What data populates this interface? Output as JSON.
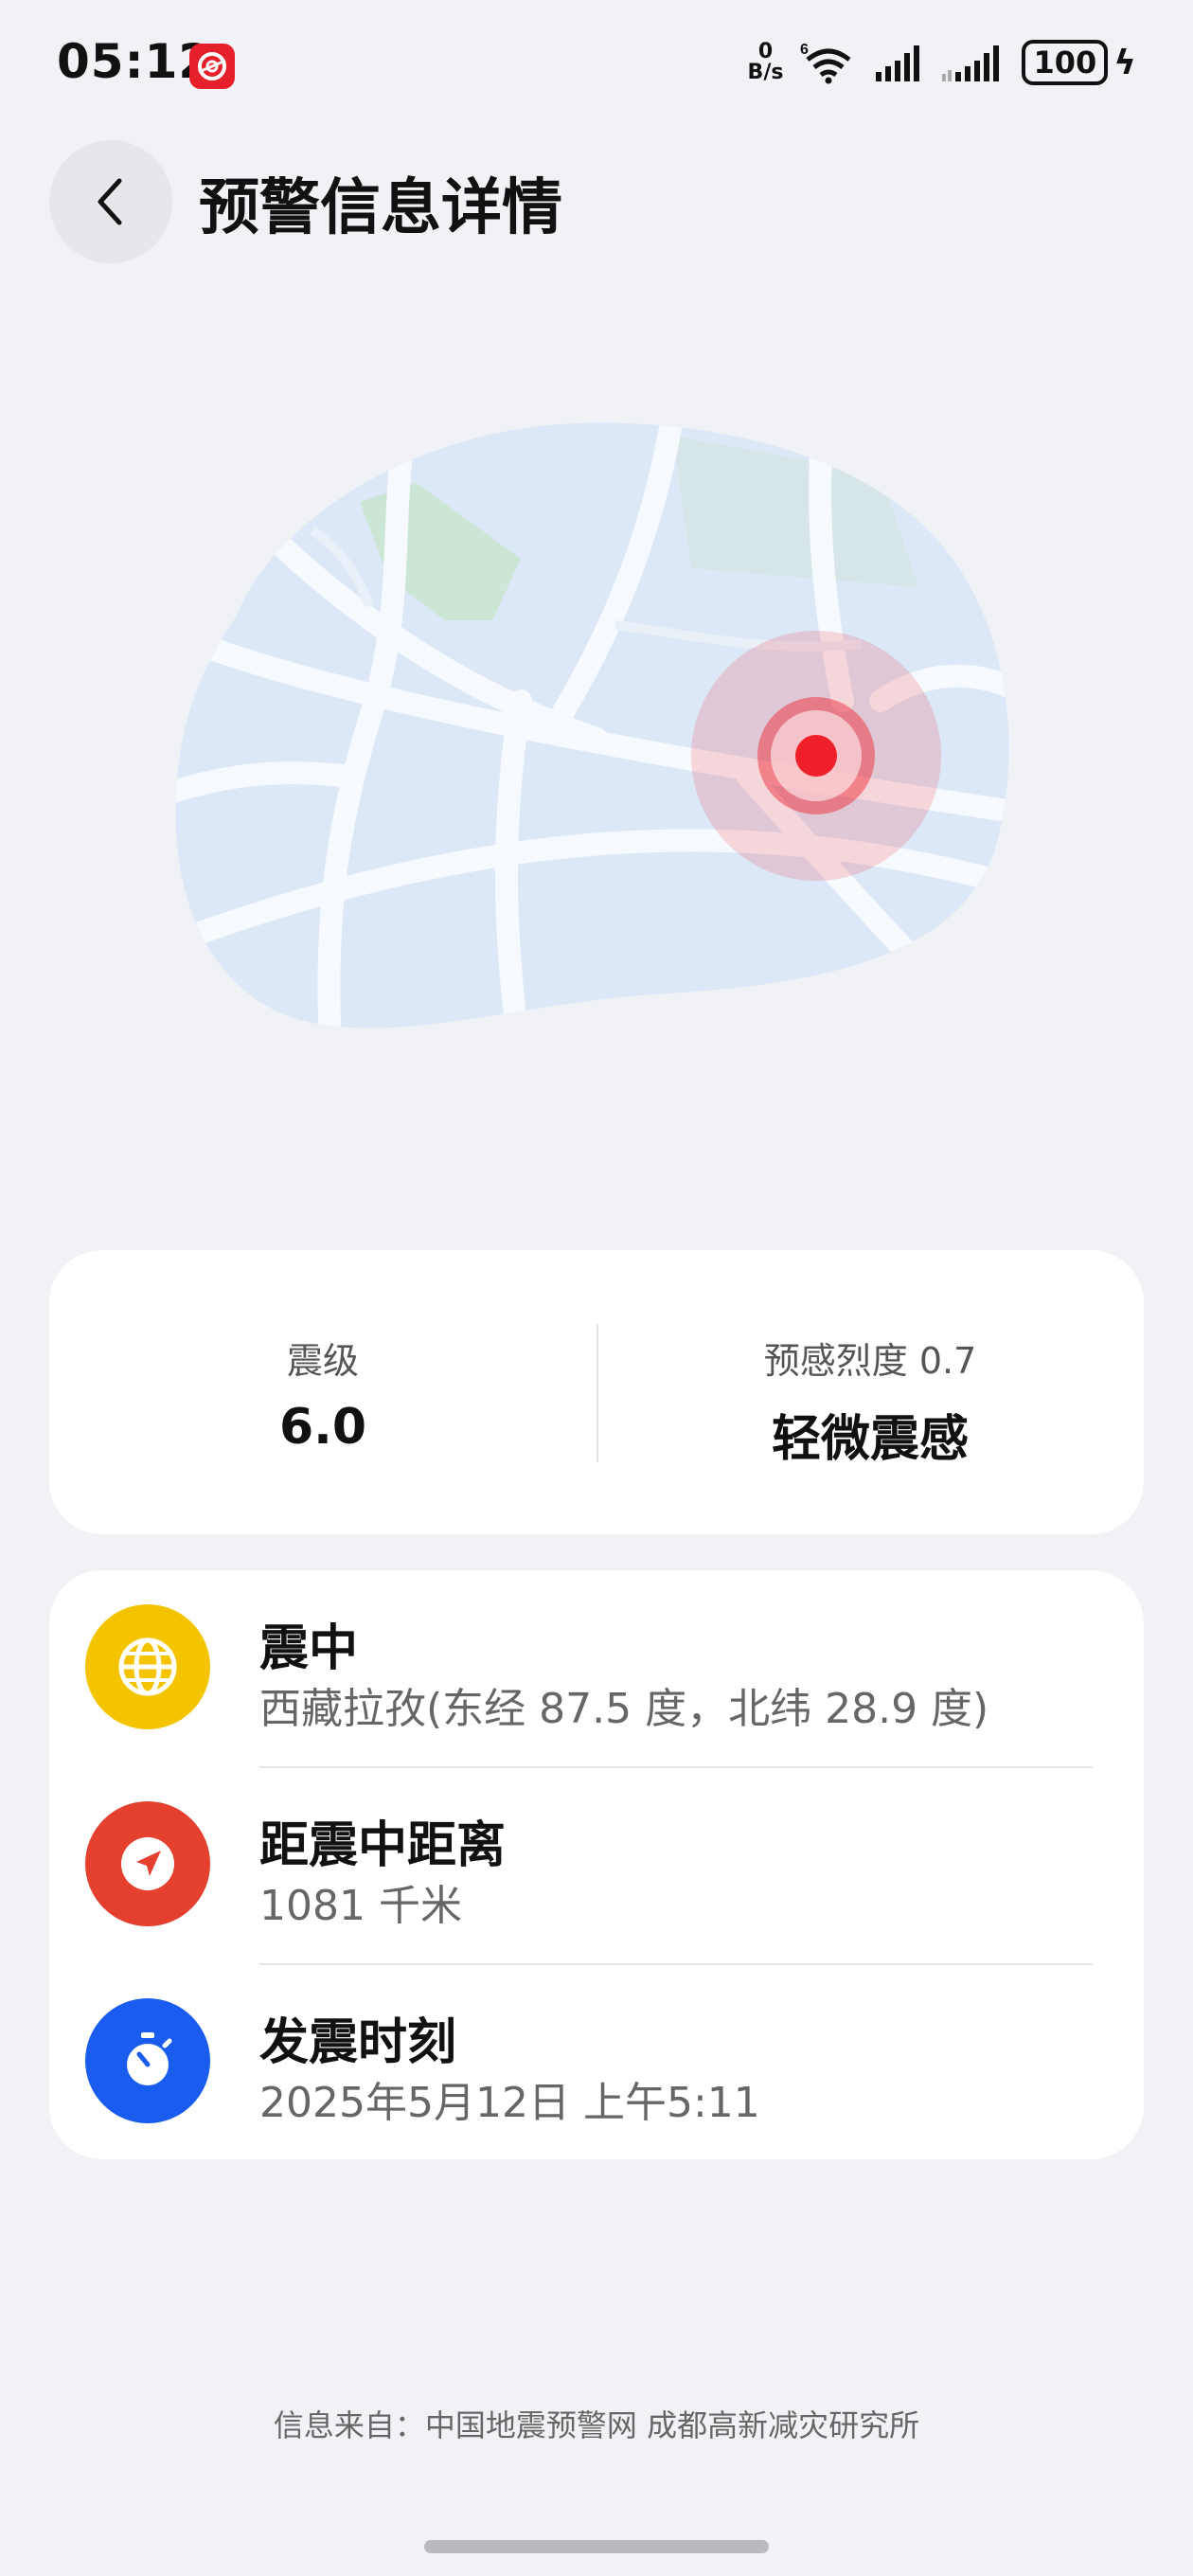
{
  "status_bar": {
    "time": "05:12",
    "net_speed_value": "0",
    "net_speed_unit": "B/s",
    "wifi_label": "6",
    "battery": "100"
  },
  "header": {
    "title": "预警信息详情"
  },
  "summary": {
    "magnitude_label": "震级",
    "magnitude_value": "6.0",
    "intensity_label": "预感烈度 0.7",
    "intensity_value": "轻微震感"
  },
  "details": [
    {
      "title": "震中",
      "value": "西藏拉孜(东经 87.5 度，北纬 28.9 度)",
      "icon": "globe-icon",
      "color": "#f5c400"
    },
    {
      "title": "距震中距离",
      "value": "1081 千米",
      "icon": "navigation-arrow-icon",
      "color": "#e5402f"
    },
    {
      "title": "发震时刻",
      "value": "2025年5月12日 上午5:11",
      "icon": "stopwatch-icon",
      "color": "#1a5cf0"
    }
  ],
  "footer": {
    "source": "信息来自：中国地震预警网 成都高新减灾研究所"
  },
  "colors": {
    "background": "#f1f2f5",
    "map_blue": "#dce8f7",
    "epicenter_red": "#f0202a"
  }
}
